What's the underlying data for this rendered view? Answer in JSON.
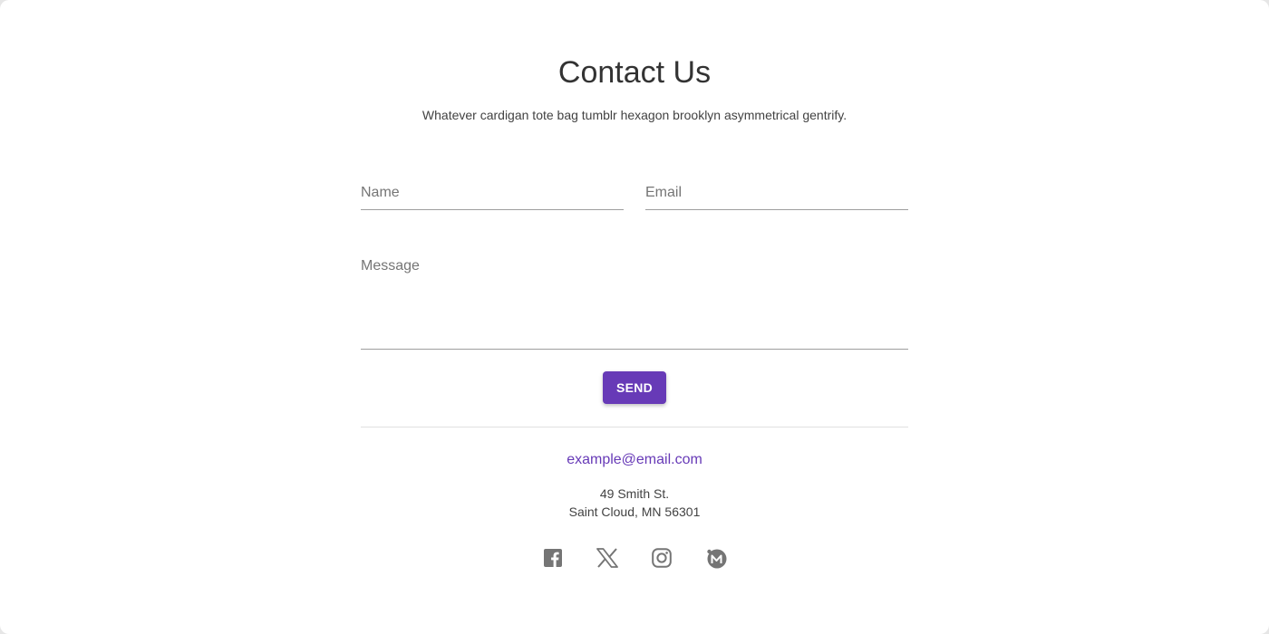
{
  "header": {
    "title": "Contact Us",
    "subtitle": "Whatever cardigan tote bag tumblr hexagon brooklyn asymmetrical gentrify."
  },
  "form": {
    "name_placeholder": "Name",
    "email_placeholder": "Email",
    "message_placeholder": "Message",
    "send_label": "SEND"
  },
  "contact": {
    "email": "example@email.com",
    "address_line1": "49 Smith St.",
    "address_line2": "Saint Cloud, MN 56301"
  },
  "social": {
    "icons": [
      "facebook-icon",
      "x-icon",
      "instagram-icon",
      "mastodon-icon"
    ]
  },
  "colors": {
    "accent": "#673ab7",
    "icon": "#757575",
    "text": "#333333"
  }
}
